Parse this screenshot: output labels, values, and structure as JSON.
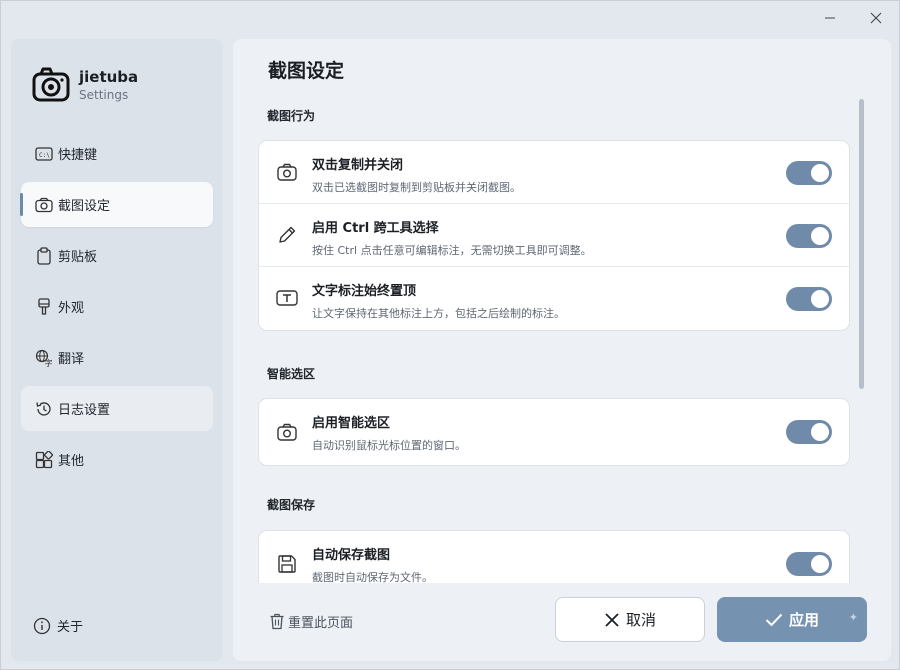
{
  "window": {
    "minimize_icon": "minimize-icon",
    "close_icon": "close-icon"
  },
  "brand": {
    "name": "jietuba",
    "subtitle": "Settings",
    "icon": "camera-icon"
  },
  "sidebar": {
    "items": [
      {
        "label": "快捷键",
        "icon": "keyboard-icon",
        "active": false
      },
      {
        "label": "截图设定",
        "icon": "camera-icon",
        "active": true
      },
      {
        "label": "剪贴板",
        "icon": "clipboard-icon",
        "active": false
      },
      {
        "label": "外观",
        "icon": "brush-icon",
        "active": false
      },
      {
        "label": "翻译",
        "icon": "translate-icon",
        "active": false
      },
      {
        "label": "日志设置",
        "icon": "history-icon",
        "active": false
      },
      {
        "label": "其他",
        "icon": "apps-icon",
        "active": false
      }
    ],
    "about_label": "关于"
  },
  "main": {
    "title": "截图设定",
    "sections": [
      {
        "title": "截图行为",
        "rows": [
          {
            "title": "双击复制并关闭",
            "desc": "双击已选截图时复制到剪贴板并关闭截图。",
            "icon": "camera-icon",
            "enabled": true
          },
          {
            "title": "启用 Ctrl 跨工具选择",
            "desc": "按住 Ctrl 点击任意可编辑标注，无需切换工具即可调整。",
            "icon": "pencil-icon",
            "enabled": true
          },
          {
            "title": "文字标注始终置顶",
            "desc": "让文字保持在其他标注上方，包括之后绘制的标注。",
            "icon": "text-box-icon",
            "enabled": true
          }
        ]
      },
      {
        "title": "智能选区",
        "rows": [
          {
            "title": "启用智能选区",
            "desc": "自动识别鼠标光标位置的窗口。",
            "icon": "camera-icon",
            "enabled": true
          }
        ]
      },
      {
        "title": "截图保存",
        "rows": [
          {
            "title": "自动保存截图",
            "desc": "截图时自动保存为文件。",
            "icon": "save-icon",
            "enabled": true
          }
        ]
      }
    ]
  },
  "footer": {
    "reset_label": "重置此页面",
    "cancel_label": "取消",
    "apply_label": "应用"
  },
  "colors": {
    "accent": "#7593b1",
    "toggle_on": "#6f8ba9"
  }
}
